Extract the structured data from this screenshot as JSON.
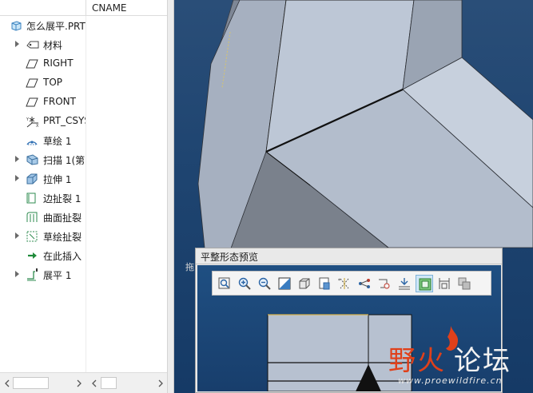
{
  "model_tree": {
    "column_header": "CNAME",
    "items": [
      {
        "label": "怎么展平.PRT",
        "icon": "part-icon",
        "expandable": false
      },
      {
        "label": "材料",
        "icon": "material-icon",
        "expandable": true
      },
      {
        "label": "RIGHT",
        "icon": "datum-plane-icon",
        "expandable": false
      },
      {
        "label": "TOP",
        "icon": "datum-plane-icon",
        "expandable": false
      },
      {
        "label": "FRONT",
        "icon": "datum-plane-icon",
        "expandable": false
      },
      {
        "label": "PRT_CSYS",
        "icon": "csys-icon",
        "expandable": false
      },
      {
        "label": "草绘 1",
        "icon": "sketch-icon",
        "expandable": false
      },
      {
        "label": "扫描 1(第",
        "icon": "sweep-icon",
        "expandable": true
      },
      {
        "label": "拉伸 1",
        "icon": "extrude-icon",
        "expandable": true
      },
      {
        "label": "边扯裂 1",
        "icon": "edge-rip-icon",
        "expandable": false
      },
      {
        "label": "曲面扯裂",
        "icon": "surface-rip-icon",
        "expandable": false
      },
      {
        "label": "草绘扯裂",
        "icon": "sketch-rip-icon",
        "expandable": true
      },
      {
        "label": "在此插入",
        "icon": "insert-here-arrow-icon",
        "expandable": false
      },
      {
        "label": "展平 1",
        "icon": "flatten-icon",
        "expandable": true
      }
    ]
  },
  "viewport": {
    "stray_text": "拖"
  },
  "preview": {
    "title": "平整形态预览",
    "toolbar": [
      {
        "name": "refit-icon"
      },
      {
        "name": "zoom-in-icon"
      },
      {
        "name": "zoom-out-icon"
      },
      {
        "name": "repaint-icon"
      },
      {
        "name": "display-style-icon"
      },
      {
        "name": "saved-orientations-icon"
      },
      {
        "name": "datum-display-icon"
      },
      {
        "name": "sketch-display-icon"
      },
      {
        "name": "spin-center-icon"
      },
      {
        "name": "annotation-display-icon"
      },
      {
        "name": "flat-pattern-view-icon"
      },
      {
        "name": "dimension-icon"
      },
      {
        "name": "layer-icon"
      }
    ]
  },
  "watermark": {
    "cn_red": "野火",
    "cn_white": "论坛",
    "url": "www.proewildfire.cn"
  },
  "colors": {
    "viewport_bg": "#1f4571",
    "model_face": "#b9c3d3",
    "model_shadow": "#7e8796",
    "accent_red": "#e0401a"
  }
}
